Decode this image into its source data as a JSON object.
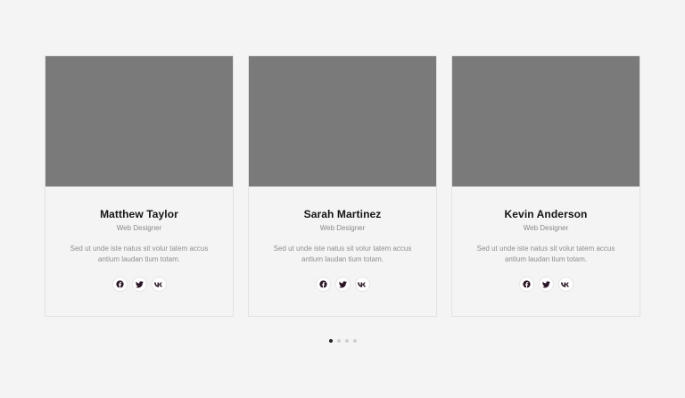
{
  "team": [
    {
      "name": "Matthew Taylor",
      "role": "Web Designer",
      "description": "Sed ut unde iste natus sit volur tatem accus antium laudan tium totam.",
      "socials": [
        "facebook-icon",
        "twitter-icon",
        "vk-icon"
      ]
    },
    {
      "name": "Sarah Martinez",
      "role": "Web Designer",
      "description": "Sed ut unde iste natus sit volur tatem accus antium laudan tium totam.",
      "socials": [
        "facebook-icon",
        "twitter-icon",
        "vk-icon"
      ]
    },
    {
      "name": "Kevin Anderson",
      "role": "Web Designer",
      "description": "Sed ut unde iste natus sit volur tatem accus antium laudan tium totam.",
      "socials": [
        "facebook-icon",
        "twitter-icon",
        "vk-icon"
      ]
    }
  ],
  "pagination": {
    "pages": 4,
    "active": 1
  },
  "colors": {
    "background": "#f4f4f4",
    "photo_placeholder": "#7a7a7b",
    "name": "#141414",
    "muted_text": "#8a8a8a",
    "icon": "#2a1626",
    "dot_active": "#222222",
    "dot_inactive": "#cfcfcf"
  }
}
